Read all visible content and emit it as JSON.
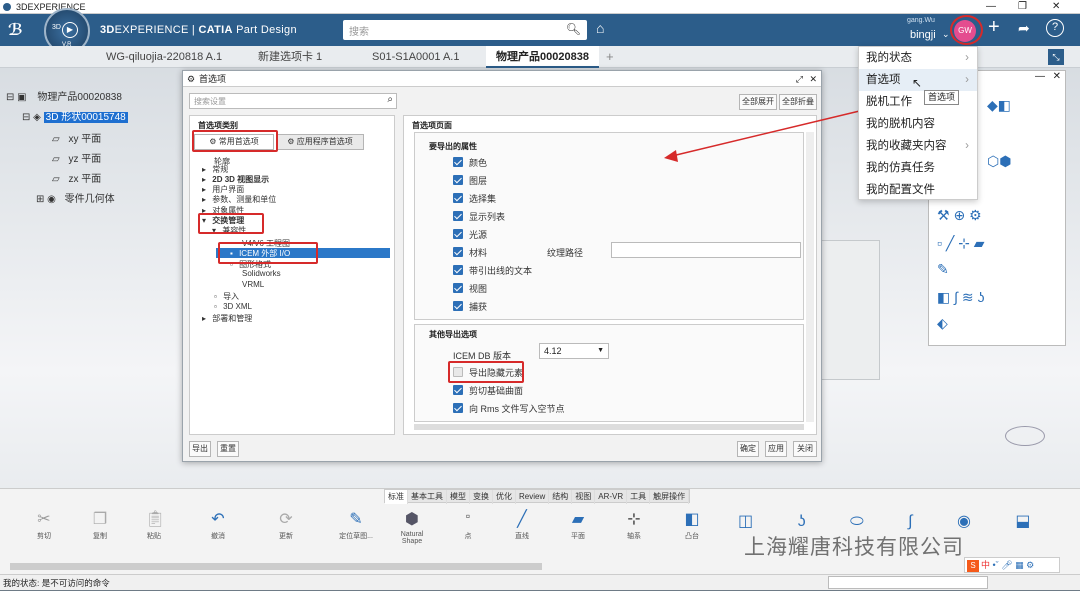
{
  "app": {
    "title": "3DEXPERIENCE"
  },
  "topbar": {
    "brand": "3DEXPERIENCE | CATIA Part Design",
    "brand_a": "3D",
    "brand_b": "EXPERIENCE | ",
    "brand_c": "CATIA",
    "brand_d": " Part Design",
    "compass_top": "3D",
    "compass_bottom": "V,R",
    "search_placeholder": "搜索",
    "user_small": "gang.Wu",
    "user_name": "bingji",
    "avatar": "GW"
  },
  "tabs": [
    "WG-qiluojia-220818 A.1",
    "新建选项卡 1",
    "S01-S1A0001 A.1",
    "物理产品00020838"
  ],
  "tree": {
    "root": "物理产品00020838",
    "shape": "3D 形状00015748",
    "xy": "xy 平面",
    "yz": "yz 平面",
    "zx": "zx 平面",
    "geo": "零件几何体"
  },
  "dialog": {
    "title": "首选项",
    "search_placeholder": "搜索设置",
    "expand_all": "全部展开",
    "collapse_all": "全部折叠",
    "category_header": "首选项类别",
    "common_tab": "常用首选项",
    "app_tab": "应用程序首选项",
    "categories": [
      "轮廓",
      "常规",
      "2D 3D 视图显示",
      "用户界面",
      "参数、测量和单位",
      "对象属性",
      "交换管理",
      "兼容性",
      "V4/V6 工程图",
      "ICEM 外部 I/O",
      "图形格式",
      "Solidworks",
      "VRML",
      "导入",
      "3D XML",
      "部署和管理"
    ],
    "page_header": "首选项页面",
    "export_props": "要导出的属性",
    "props": [
      "颜色",
      "图层",
      "选择集",
      "显示列表",
      "光源",
      "材料",
      "带引出线的文本",
      "视图",
      "捕获"
    ],
    "texture_label": "纹理路径",
    "other_header": "其他导出选项",
    "icem_version_label": "ICEM DB 版本",
    "icem_version": "4.12",
    "other_opts": [
      "导出隐藏元素",
      "剪切基础曲面",
      "向 Rms 文件写入空节点"
    ],
    "export_btn": "导出",
    "reset_btn": "重置",
    "ok_btn": "确定",
    "apply_btn": "应用",
    "close_btn": "关闭"
  },
  "menu": {
    "items": [
      "我的状态",
      "首选项",
      "脱机工作",
      "我的脱机内容",
      "我的收藏夹内容",
      "我的仿真任务",
      "我的配置文件"
    ],
    "tooltip": "首选项"
  },
  "bottom": {
    "tabs": [
      "标准",
      "基本工具",
      "模型",
      "变换",
      "优化",
      "Review",
      "结构",
      "视图",
      "AR-VR",
      "工具",
      "触屏操作"
    ],
    "tools": [
      "剪切",
      "复制",
      "粘贴",
      "撤消",
      "更新",
      "定位草图...",
      "Natural Shape",
      "点",
      "直线",
      "平面",
      "轴系",
      "凸台"
    ]
  },
  "status": "我的状态: 是不可访问的命令",
  "watermark": "上海耀唐科技有限公司",
  "ime": "中"
}
